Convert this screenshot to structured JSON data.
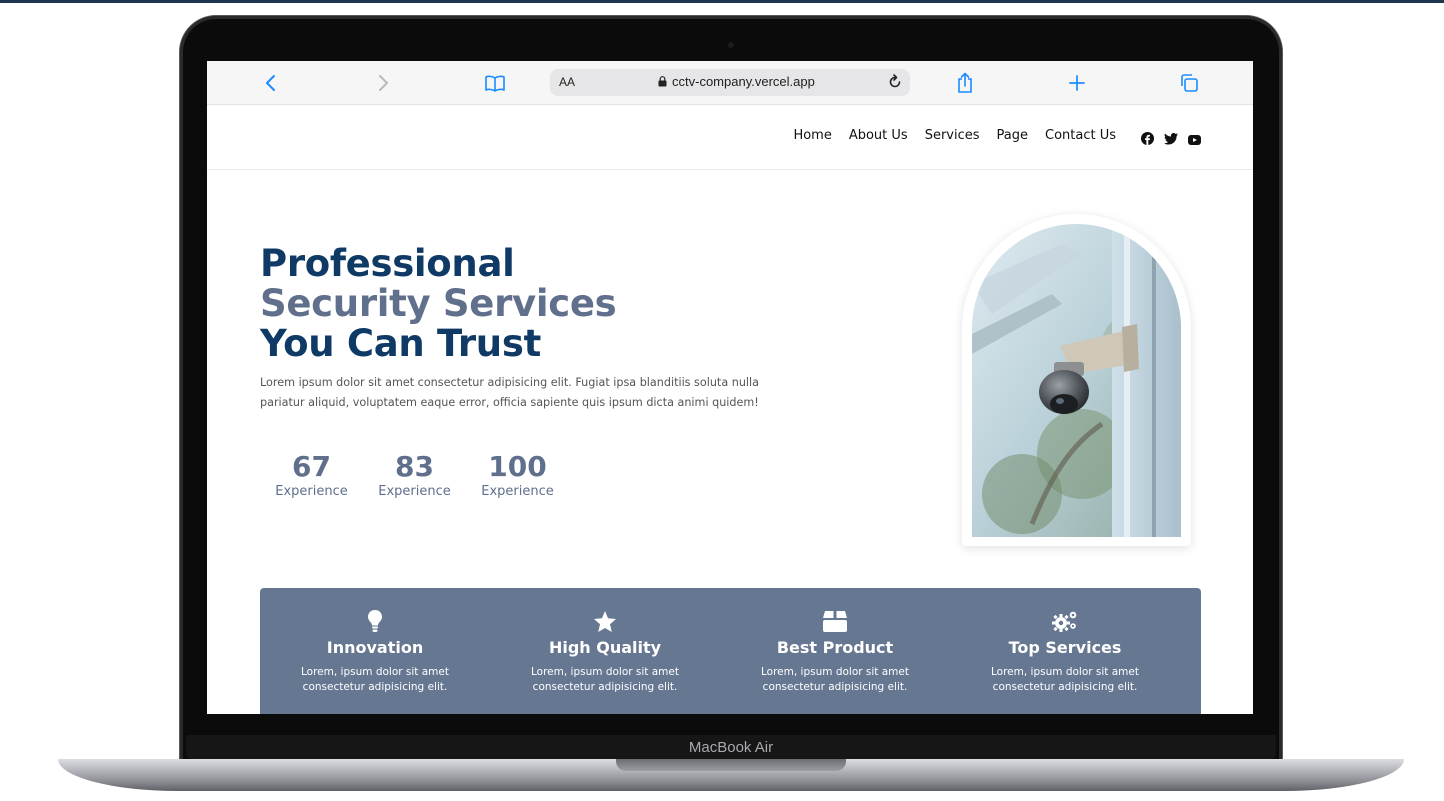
{
  "device": {
    "label": "MacBook Air"
  },
  "browser": {
    "text_size_label": "AA",
    "url": "cctv-company.vercel.app",
    "icons": [
      "back-icon",
      "forward-icon",
      "bookmarks-icon",
      "lock-icon",
      "reload-icon",
      "share-icon",
      "new-tab-icon",
      "tabs-icon"
    ]
  },
  "nav": {
    "items": [
      "Home",
      "About Us",
      "Services",
      "Page",
      "Contact Us"
    ],
    "social": [
      "facebook-icon",
      "twitter-icon",
      "youtube-icon"
    ]
  },
  "hero": {
    "title_line1": "Professional",
    "title_line2": "Security Services",
    "title_line3": "You Can Trust",
    "description": "Lorem ipsum dolor sit amet consectetur adipisicing elit. Fugiat ipsa blanditiis soluta nulla pariatur aliquid, voluptatem eaque error, officia sapiente quis ipsum dicta animi quidem!",
    "stats": [
      {
        "value": "67",
        "label": "Experience"
      },
      {
        "value": "83",
        "label": "Experience"
      },
      {
        "value": "100",
        "label": "Experience"
      }
    ]
  },
  "features": [
    {
      "icon": "lightbulb-icon",
      "title": "Innovation",
      "text_line1": "Lorem, ipsum dolor sit amet",
      "text_line2": "consectetur adipisicing elit."
    },
    {
      "icon": "star-icon",
      "title": "High Quality",
      "text_line1": "Lorem, ipsum dolor sit amet",
      "text_line2": "consectetur adipisicing elit."
    },
    {
      "icon": "box-icon",
      "title": "Best Product",
      "text_line1": "Lorem, ipsum dolor sit amet",
      "text_line2": "consectetur adipisicing elit."
    },
    {
      "icon": "gears-icon",
      "title": "Top Services",
      "text_line1": "Lorem, ipsum dolor sit amet",
      "text_line2": "consectetur adipisicing elit."
    }
  ],
  "colors": {
    "brand_dark": "#0f3a66",
    "brand_muted": "#5f6f8c",
    "feature_bg": "#667792",
    "safari_accent": "#1a8cff"
  }
}
